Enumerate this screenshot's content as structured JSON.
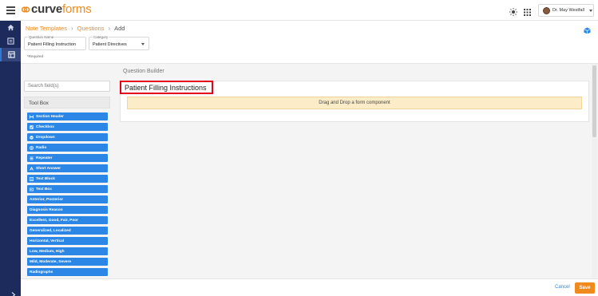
{
  "app": {
    "logo_part1": "curve",
    "logo_part2": "forms",
    "user_name": "Dr. May Westfall"
  },
  "breadcrumb": {
    "items": [
      "Note Templates",
      "Questions",
      "Add"
    ]
  },
  "form": {
    "question_name_label": "Question Name",
    "question_name_value": "Patient Filling Instruction",
    "category_label": "Category",
    "category_value": "Patient Directives",
    "required_note": "*Required"
  },
  "toolbox": {
    "search_placeholder": "Search field(s)",
    "title": "Tool Box",
    "items": [
      {
        "label": "Section Header",
        "icon": "header-icon"
      },
      {
        "label": "Checkbox",
        "icon": "checkbox-icon"
      },
      {
        "label": "Dropdown",
        "icon": "dropdown-icon"
      },
      {
        "label": "Radio",
        "icon": "radio-icon"
      },
      {
        "label": "Repeater",
        "icon": "repeater-icon"
      },
      {
        "label": "Short Answer",
        "icon": "short-answer-icon"
      },
      {
        "label": "Text Block",
        "icon": "text-block-icon"
      },
      {
        "label": "Text Box",
        "icon": "text-box-icon"
      },
      {
        "label": "Anterior, Posterior",
        "icon": ""
      },
      {
        "label": "Diagnosis Reason",
        "icon": ""
      },
      {
        "label": "Excellent, Good, Fair, Poor",
        "icon": ""
      },
      {
        "label": "Generalized, Localized",
        "icon": ""
      },
      {
        "label": "Horizontal, Vertical",
        "icon": ""
      },
      {
        "label": "Low, Medium, High",
        "icon": ""
      },
      {
        "label": "Mild, Moderate, Severe",
        "icon": ""
      },
      {
        "label": "Radiographs",
        "icon": ""
      }
    ]
  },
  "builder": {
    "label": "Question Builder",
    "title": "Patient Filling Instructions",
    "dropzone_text": "Drag and Drop a form component"
  },
  "footer": {
    "cancel_label": "Cancel",
    "save_label": "Save"
  },
  "colors": {
    "brand_orange": "#f18a1e",
    "rail_navy": "#1d2a5c",
    "tool_blue": "#2b86e6",
    "highlight_red": "#e3001b"
  }
}
